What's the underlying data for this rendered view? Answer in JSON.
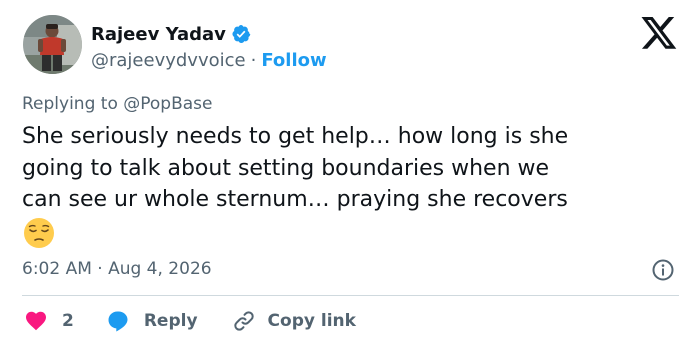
{
  "tweet": {
    "author": {
      "display_name": "Rajeev Yadav",
      "handle": "@rajeevydvvoice",
      "separator": "·",
      "follow_label": "Follow",
      "verified": true
    },
    "replying_to": "Replying to @PopBase",
    "text": "She seriously needs to get help… how long is she\ngoing to talk about setting boundaries when we\ncan see ur whole sternum… praying she recovers",
    "emoji": "pensive-face",
    "timestamp": "6:02 AM · Aug 4, 2026",
    "actions": {
      "like_count": "2",
      "reply_label": "Reply",
      "copy_link_label": "Copy link"
    }
  },
  "colors": {
    "text": "#0f1419",
    "secondary": "#536471",
    "accent": "#1d9bf0",
    "like": "#f91880",
    "divider": "#cfd9de"
  },
  "icons": [
    "verified-badge-icon",
    "x-logo-icon",
    "info-icon",
    "heart-icon",
    "reply-bubble-icon",
    "link-icon",
    "pensive-face-emoji"
  ]
}
